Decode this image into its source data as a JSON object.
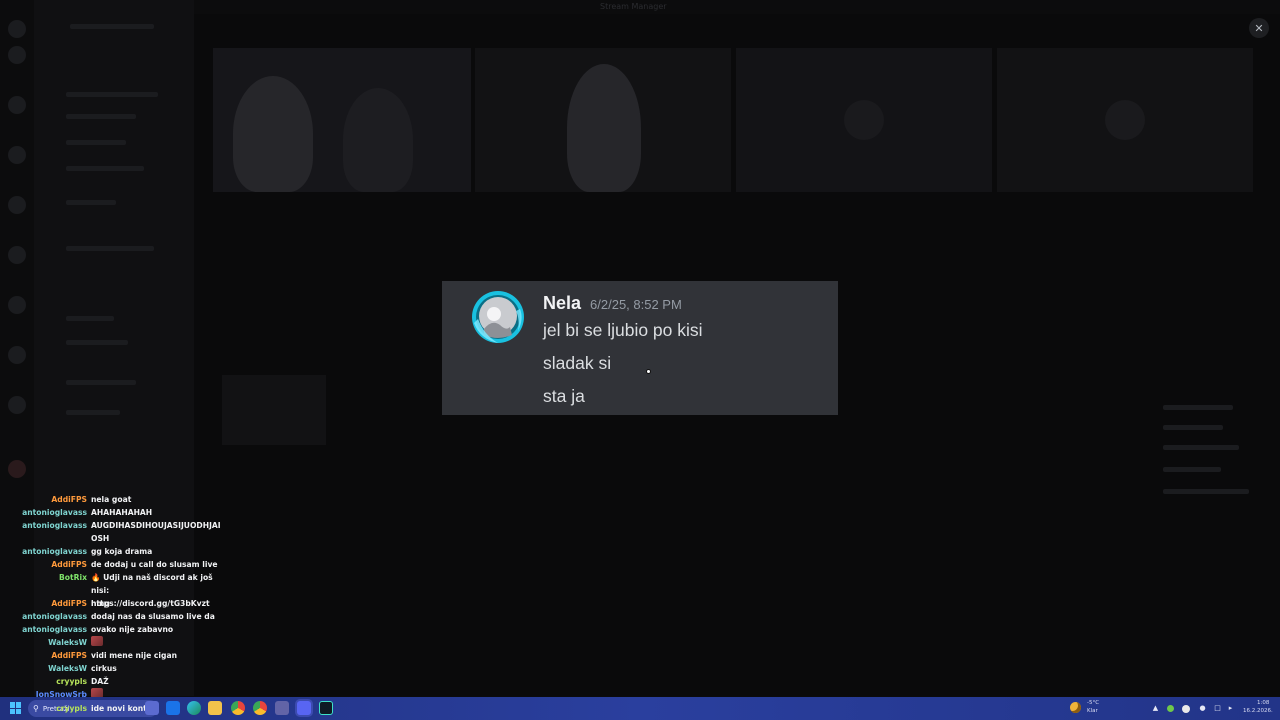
{
  "window": {
    "title": "Stream Manager",
    "close_glyph": "✕"
  },
  "message": {
    "author": "Nela",
    "timestamp": "6/2/25, 8:52 PM",
    "lines": [
      "jel bi se ljubio po kisi",
      "sladak si",
      "sta ja"
    ],
    "avatar_icon": "user-avatar-icon",
    "colors": {
      "card": "#313338",
      "author": "#f2f3f5",
      "text": "#dbdee1",
      "timestamp": "#949ba4",
      "avatar_ring": "#19c1e0"
    }
  },
  "chat": [
    {
      "user": "AddiFPS",
      "color": "#ff9a3c",
      "text": "nela goat"
    },
    {
      "user": "antonioglavass",
      "color": "#7fd4d0",
      "text": "AHAHAHAHAH"
    },
    {
      "user": "antonioglavass",
      "color": "#7fd4d0",
      "text": "AUGDIHASDIHOUJASIJUODHJAIOSH"
    },
    {
      "user": "antonioglavass",
      "color": "#7fd4d0",
      "text": "gg koja drama"
    },
    {
      "user": "AddiFPS",
      "color": "#ff9a3c",
      "text": "de dodaj u call do slusam live"
    },
    {
      "user": "BotRix",
      "color": "#7fe36a",
      "text": "🔥 Udji na naš discord ak još nisi: https://discord.gg/tG3bKvzt"
    },
    {
      "user": "AddiFPS",
      "color": "#ff9a3c",
      "text": "nmg"
    },
    {
      "user": "antonioglavass",
      "color": "#7fd4d0",
      "text": "dodaj nas da slusamo live da"
    },
    {
      "user": "antonioglavass",
      "color": "#7fd4d0",
      "text": "ovako nije zabavno"
    },
    {
      "user": "WaleksW",
      "color": "#7fd4d0",
      "text": "",
      "emote": true
    },
    {
      "user": "AddiFPS",
      "color": "#ff9a3c",
      "text": "vidi mene nije cigan"
    },
    {
      "user": "WaleksW",
      "color": "#7fd4d0",
      "text": "cirkus"
    },
    {
      "user": "cryypls",
      "color": "#b6e35a",
      "text": "DAŽ"
    },
    {
      "user": "JonSnowSrb",
      "color": "#5b8cff",
      "text": "",
      "emote": true
    },
    {
      "user": "cryypls",
      "color": "#b6e35a",
      "text": "ide novi konte"
    }
  ],
  "taskbar": {
    "search_placeholder": "Pretraži",
    "weather_temp": "-5°C",
    "weather_desc": "Klar",
    "time": "1:08",
    "date": "16.2.2026.",
    "apps": [
      "widgets-icon",
      "outlook-icon",
      "edge-icon",
      "file-explorer-icon",
      "chrome-icon",
      "google-chrome-icon",
      "teams-icon",
      "discord-icon",
      "terminal-icon"
    ]
  }
}
